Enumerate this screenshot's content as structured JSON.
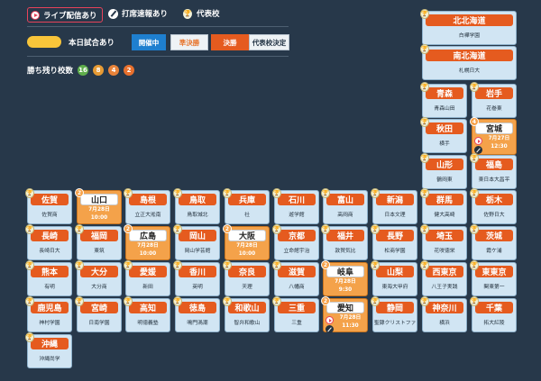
{
  "legend": {
    "live": "ライブ配信あり",
    "batting": "打席速報あり",
    "representative": "代表校",
    "today": "本日試合あり",
    "status_live": "開催中",
    "status_semi": "準決勝",
    "status_final": "決勝",
    "status_decided": "代表校決定",
    "remaining_label": "勝ち残り校数",
    "remaining_counts": [
      {
        "value": "16",
        "color": "#5fae4c"
      },
      {
        "value": "8",
        "color": "#e79b34"
      },
      {
        "value": "4",
        "color": "#e8833a"
      },
      {
        "value": "2",
        "color": "#e8702d"
      }
    ],
    "trophy_glyph": "🏆"
  },
  "prefectures": [
    {
      "id": "hokkaido-north",
      "name": "北北海道",
      "school": "白樺学園",
      "badge": "trophy"
    },
    {
      "id": "hokkaido-south",
      "name": "南北海道",
      "school": "札幌日大",
      "badge": "trophy"
    },
    {
      "id": "aomori",
      "name": "青森",
      "school": "青森山田",
      "badge": "trophy"
    },
    {
      "id": "iwate",
      "name": "岩手",
      "school": "花巻東",
      "badge": "trophy"
    },
    {
      "id": "akita",
      "name": "秋田",
      "school": "横手",
      "badge": "trophy"
    },
    {
      "id": "miyagi",
      "name": "宮城",
      "info": "7月27日\n12:30",
      "badge": "4",
      "today": true,
      "live": true,
      "bat": true
    },
    {
      "id": "yamagata",
      "name": "山形",
      "school": "鶴岡東",
      "badge": "trophy"
    },
    {
      "id": "fukushima",
      "name": "福島",
      "school": "東日本大昌平",
      "badge": "trophy"
    },
    {
      "id": "saga",
      "name": "佐賀",
      "school": "佐賀商",
      "badge": "trophy"
    },
    {
      "id": "yamaguchi",
      "name": "山口",
      "info": "7月28日\n10:00",
      "badge": "2",
      "today": true
    },
    {
      "id": "shimane",
      "name": "島根",
      "school": "立正大淞南",
      "badge": "trophy"
    },
    {
      "id": "tottori",
      "name": "鳥取",
      "school": "鳥取城北",
      "badge": "trophy"
    },
    {
      "id": "hyogo",
      "name": "兵庫",
      "school": "社",
      "badge": "trophy"
    },
    {
      "id": "ishikawa",
      "name": "石川",
      "school": "遊学館",
      "badge": "trophy"
    },
    {
      "id": "toyama",
      "name": "富山",
      "school": "高岡商",
      "badge": "trophy"
    },
    {
      "id": "niigata",
      "name": "新潟",
      "school": "日本文理",
      "badge": "trophy"
    },
    {
      "id": "gunma",
      "name": "群馬",
      "school": "健大高崎",
      "badge": "trophy"
    },
    {
      "id": "tochigi",
      "name": "栃木",
      "school": "佐野日大",
      "badge": "trophy"
    },
    {
      "id": "nagasaki",
      "name": "長崎",
      "school": "長崎日大",
      "badge": "trophy"
    },
    {
      "id": "fukuoka",
      "name": "福岡",
      "school": "東筑",
      "badge": "trophy"
    },
    {
      "id": "hiroshima",
      "name": "広島",
      "info": "7月28日\n10:00",
      "badge": "2",
      "today": true
    },
    {
      "id": "okayama",
      "name": "岡山",
      "school": "岡山学芸館",
      "badge": "trophy"
    },
    {
      "id": "osaka",
      "name": "大阪",
      "info": "7月28日\n10:00",
      "badge": "2",
      "today": true
    },
    {
      "id": "kyoto",
      "name": "京都",
      "school": "立命館宇治",
      "badge": "trophy"
    },
    {
      "id": "fukui",
      "name": "福井",
      "school": "敦賀気比",
      "badge": "trophy"
    },
    {
      "id": "nagano",
      "name": "長野",
      "school": "松商学園",
      "badge": "trophy"
    },
    {
      "id": "saitama",
      "name": "埼玉",
      "school": "花咲徳栄",
      "badge": "trophy"
    },
    {
      "id": "ibaraki",
      "name": "茨城",
      "school": "霞ケ浦",
      "badge": "trophy"
    },
    {
      "id": "kumamoto",
      "name": "熊本",
      "school": "有明",
      "badge": "trophy"
    },
    {
      "id": "oita",
      "name": "大分",
      "school": "大分商",
      "badge": "trophy"
    },
    {
      "id": "ehime",
      "name": "愛媛",
      "school": "新田",
      "badge": "trophy"
    },
    {
      "id": "kagawa",
      "name": "香川",
      "school": "英明",
      "badge": "trophy"
    },
    {
      "id": "nara",
      "name": "奈良",
      "school": "天理",
      "badge": "trophy"
    },
    {
      "id": "shiga",
      "name": "滋賀",
      "school": "八幡商",
      "badge": "trophy"
    },
    {
      "id": "gifu",
      "name": "岐阜",
      "info": "7月28日\n9:30",
      "badge": "2",
      "today": true
    },
    {
      "id": "yamanashi",
      "name": "山梨",
      "school": "東海大甲府",
      "badge": "trophy"
    },
    {
      "id": "west-tokyo",
      "name": "西東京",
      "school": "八王子実践",
      "badge": "trophy"
    },
    {
      "id": "east-tokyo",
      "name": "東東京",
      "school": "関東第一",
      "badge": "trophy"
    },
    {
      "id": "kagoshima",
      "name": "鹿児島",
      "school": "神村学園",
      "badge": "trophy"
    },
    {
      "id": "miyazaki",
      "name": "宮崎",
      "school": "日南学園",
      "badge": "trophy"
    },
    {
      "id": "kochi",
      "name": "高知",
      "school": "明徳義塾",
      "badge": "trophy"
    },
    {
      "id": "tokushima",
      "name": "徳島",
      "school": "鳴門渦潮",
      "badge": "trophy"
    },
    {
      "id": "wakayama",
      "name": "和歌山",
      "school": "智弁和歌山",
      "badge": "trophy"
    },
    {
      "id": "mie",
      "name": "三重",
      "school": "三重",
      "badge": "trophy"
    },
    {
      "id": "aichi",
      "name": "愛知",
      "info": "7月28日\n11:30",
      "badge": "2",
      "today": true,
      "live": true,
      "bat": true
    },
    {
      "id": "shizuoka",
      "name": "静岡",
      "school": "聖隷クリストファー",
      "badge": "trophy"
    },
    {
      "id": "kanagawa",
      "name": "神奈川",
      "school": "横浜",
      "badge": "trophy"
    },
    {
      "id": "chiba",
      "name": "千葉",
      "school": "拓大紅陵",
      "badge": "trophy"
    },
    {
      "id": "okinawa",
      "name": "沖縄",
      "school": "沖縄尚学",
      "badge": "trophy"
    }
  ]
}
